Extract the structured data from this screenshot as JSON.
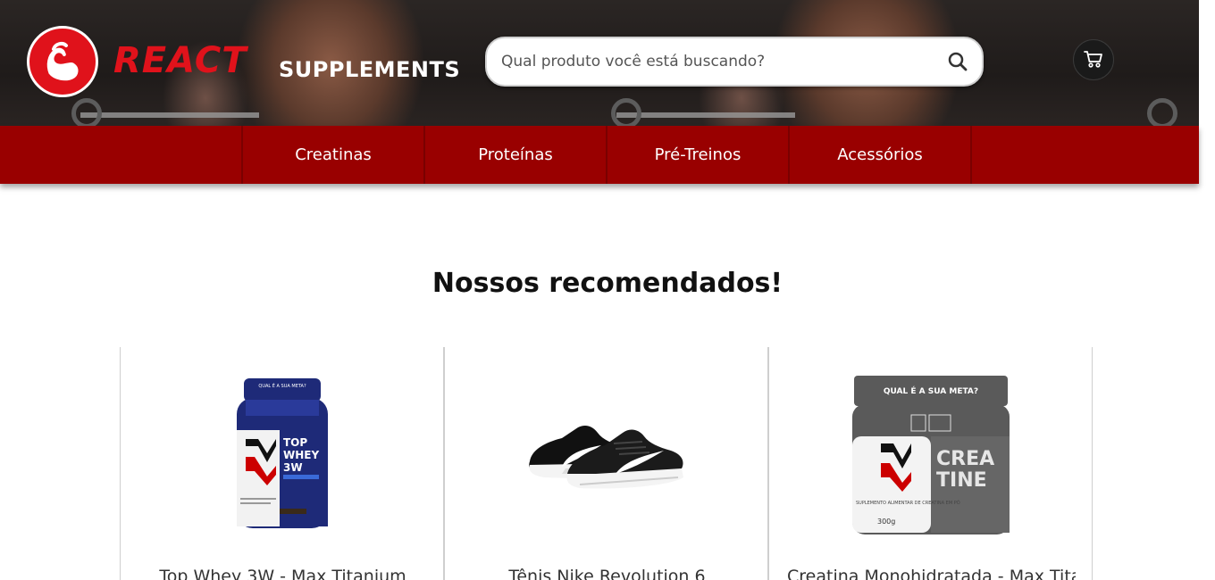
{
  "brand": {
    "name_part1": "REACT",
    "name_part2": "SUPPLEMENTS"
  },
  "search": {
    "placeholder": "Qual produto você está buscando?"
  },
  "nav": {
    "items": [
      "Creatinas",
      "Proteínas",
      "Pré-Treinos",
      "Acessórios"
    ]
  },
  "main": {
    "title": "Nossos recomendados!",
    "products": [
      {
        "name": "Top Whey 3W - Max Titanium",
        "image_text": {
          "top": "QUAL É A SUA META?",
          "line1": "TOP",
          "line2": "WHEY",
          "line3": "3W"
        }
      },
      {
        "name": "Tênis Nike Revolution 6"
      },
      {
        "name": "Creatina Monohidratada - Max Titanium",
        "image_text": {
          "top": "QUAL É A SUA META?",
          "line1": "CREA",
          "line2": "TINE",
          "weight": "300g",
          "desc": "SUPLEMENTO ALIMENTAR DE CREATINA EM PÓ"
        }
      }
    ]
  },
  "colors": {
    "brand_red": "#e0121b",
    "nav_red": "#990000",
    "dark_bg": "#1f1b1a"
  },
  "icons": {
    "logo": "flexed-arm-icon",
    "search": "search-icon",
    "cart": "shopping-cart-icon"
  }
}
